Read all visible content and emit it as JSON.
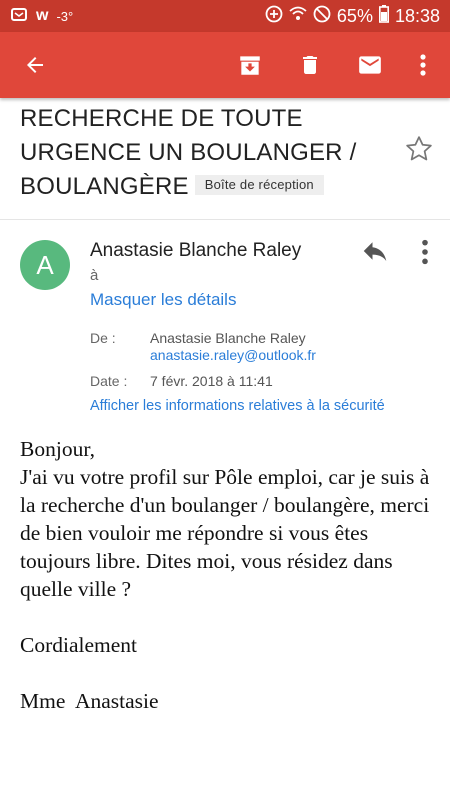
{
  "status_bar": {
    "temperature": "-3°",
    "battery": "65%",
    "time": "18:38"
  },
  "email": {
    "subject": "RECHERCHE DE TOUTE URGENCE UN BOULANGER / BOULANGÈRE",
    "label": "Boîte de réception",
    "sender_initial": "A",
    "sender_name": "Anastasie Blanche Raley",
    "to_label": "à",
    "hide_details": "Masquer les détails",
    "from_label": "De :",
    "from_name": "Anastasie Blanche Raley",
    "from_email": "anastasie.raley@outlook.fr",
    "date_label": "Date :",
    "date_value": "7 févr. 2018 à 11:41",
    "security_link": "Afficher les informations relatives à la sécurité",
    "body_paragraph": "Bonjour,\nJ'ai vu votre profil sur Pôle emploi, car je suis à la recherche d'un boulanger / boulangère, merci de bien vouloir me répondre si vous êtes toujours libre. Dites moi, vous résidez dans quelle ville ?",
    "closing": "Cordialement",
    "signature": "Mme  Anastasie"
  },
  "colors": {
    "status_bar": "#c5392c",
    "app_bar": "#e0473a",
    "avatar": "#58b97e",
    "link": "#2a7dd8"
  }
}
